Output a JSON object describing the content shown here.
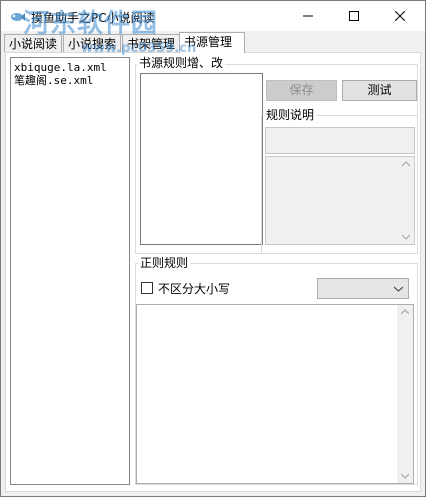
{
  "window": {
    "title": "摸鱼助手之PC小说阅读",
    "watermark": "河东软件园",
    "watermark_url": "www.pc0359.cn"
  },
  "tabs": [
    {
      "label": "小说阅读",
      "active": false
    },
    {
      "label": "小说搜索",
      "active": false
    },
    {
      "label": "书架管理",
      "active": false
    },
    {
      "label": "书源管理",
      "active": true
    }
  ],
  "file_list": {
    "items": [
      "xbiquge.la.xml",
      "笔趣阁.se.xml"
    ]
  },
  "rule_editor": {
    "group_label": "书源规则增、改",
    "save_label": "保存",
    "test_label": "测试",
    "description_label": "规则说明"
  },
  "regex": {
    "group_label": "正则规则",
    "case_insensitive_label": "不区分大小写",
    "case_insensitive_checked": false,
    "selected_option": ""
  },
  "colors": {
    "accent": "#3c8cd2",
    "disabled_text": "#8d8d8d"
  }
}
